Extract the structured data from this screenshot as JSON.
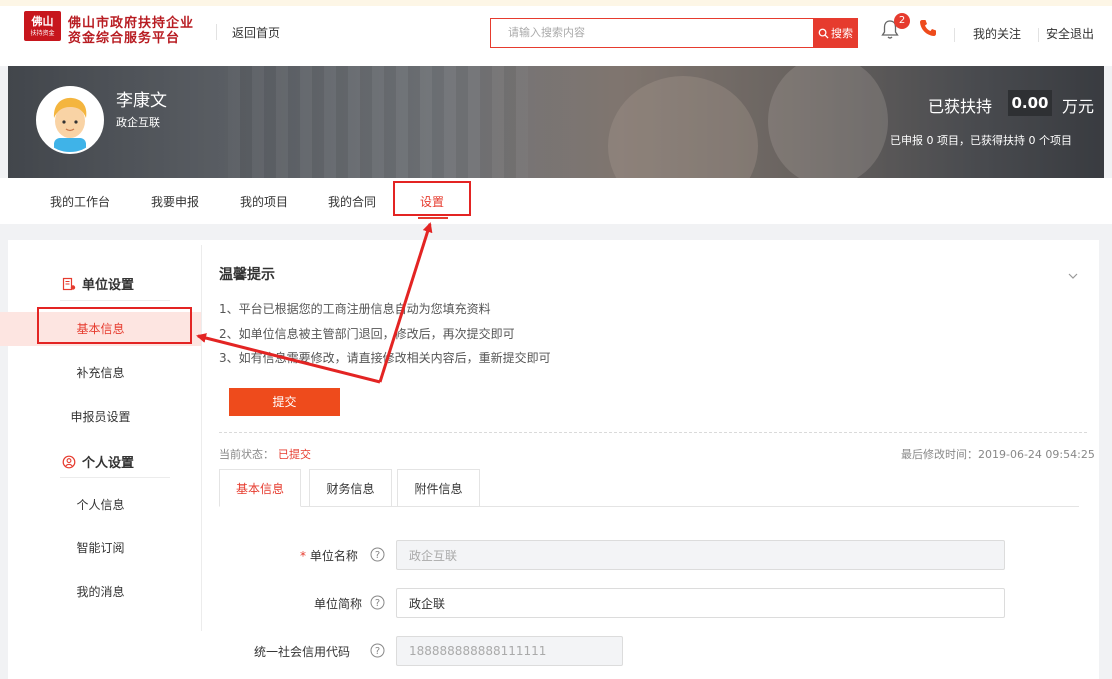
{
  "header": {
    "logo_small": "佛山",
    "logo_tiny": "扶持资金",
    "title_line1": "佛山市政府扶持企业",
    "title_line2": "资金综合服务平台",
    "back_home": "返回首页",
    "search_placeholder": "请输入搜索内容",
    "search_button": "搜索",
    "notification_count": "2",
    "links": [
      "我的关注",
      "安全退出"
    ]
  },
  "profile": {
    "name": "李康文",
    "org": "政企互联",
    "support_label": "已获扶持",
    "support_amount": "0.00",
    "support_unit": "万元",
    "summary": "已申报 0 项目，已获得扶持 0 个项目"
  },
  "nav": {
    "items": [
      "我的工作台",
      "我要申报",
      "我的项目",
      "我的合同",
      "设置"
    ],
    "active": "设置"
  },
  "sidebar": {
    "groups": [
      {
        "title": "单位设置",
        "items": [
          "基本信息",
          "补充信息",
          "申报员设置"
        ]
      },
      {
        "title": "个人设置",
        "items": [
          "个人信息",
          "智能订阅",
          "我的消息"
        ]
      }
    ],
    "active": "基本信息"
  },
  "tips": {
    "title": "温馨提示",
    "lines": [
      "1、平台已根据您的工商注册信息自动为您填充资料",
      "2、如单位信息被主管部门退回，修改后，再次提交即可",
      "3、如有信息需要修改，请直接修改相关内容后，重新提交即可"
    ],
    "submit": "提交"
  },
  "status": {
    "label": "当前状态：",
    "value": "已提交",
    "modified": "最后修改时间：2019-06-24 09:54:25"
  },
  "tabs": [
    "基本信息",
    "财务信息",
    "附件信息"
  ],
  "form": {
    "required_mark": "*",
    "fields": [
      {
        "label": "单位名称",
        "value": "政企互联",
        "disabled": true
      },
      {
        "label": "单位简称",
        "value": "政企联",
        "disabled": false
      },
      {
        "label": "统一社会信用代码",
        "value": "188888888888111111",
        "disabled": true
      }
    ]
  },
  "colors": {
    "accent": "#e63b2e",
    "button": "#ee4b1c",
    "annotation": "#e32423"
  }
}
